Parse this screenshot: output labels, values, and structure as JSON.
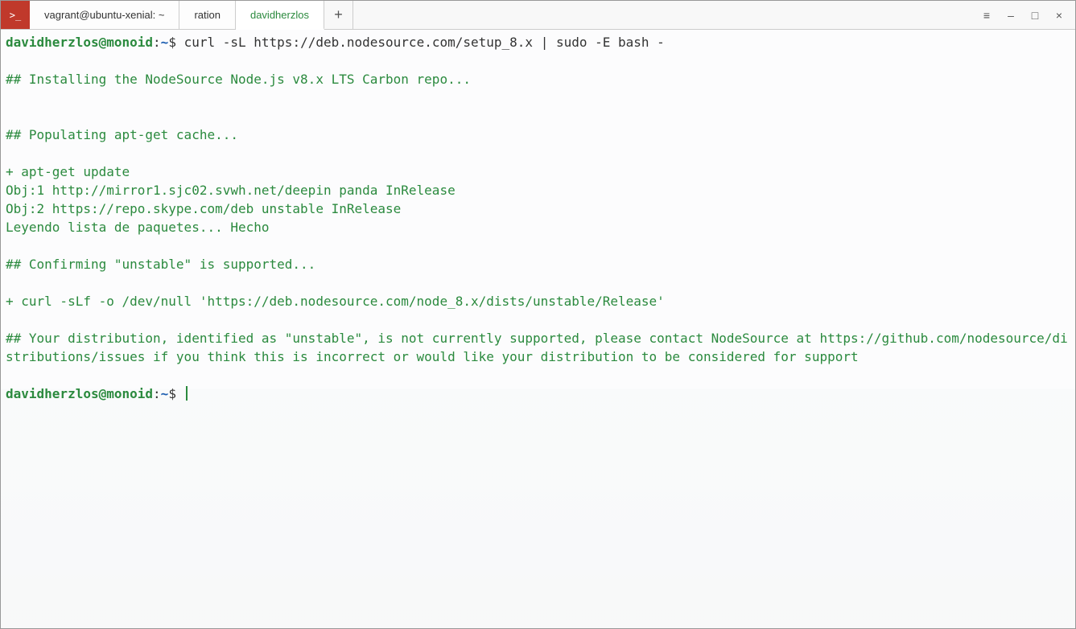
{
  "titlebar": {
    "app_icon_glyph": ">_",
    "tabs": [
      {
        "label": "vagrant@ubuntu-xenial: ~",
        "active": false
      },
      {
        "label": "ration",
        "active": false
      },
      {
        "label": "davidherzlos",
        "active": true
      }
    ],
    "new_tab_glyph": "+",
    "controls": {
      "menu": "≡",
      "minimize": "–",
      "maximize": "□",
      "close": "×"
    }
  },
  "prompt": {
    "user": "davidherzlos@monoid",
    "sep1": ":",
    "path": "~",
    "sep2": "$ "
  },
  "session": {
    "command": "curl -sL https://deb.nodesource.com/setup_8.x | sudo -E bash -",
    "lines": [
      "",
      "## Installing the NodeSource Node.js v8.x LTS Carbon repo...",
      "",
      "",
      "## Populating apt-get cache...",
      "",
      "+ apt-get update",
      "Obj:1 http://mirror1.sjc02.svwh.net/deepin panda InRelease",
      "Obj:2 https://repo.skype.com/deb unstable InRelease",
      "Leyendo lista de paquetes... Hecho",
      "",
      "## Confirming \"unstable\" is supported...",
      "",
      "+ curl -sLf -o /dev/null 'https://deb.nodesource.com/node_8.x/dists/unstable/Release'",
      "",
      "## Your distribution, identified as \"unstable\", is not currently supported, please contact NodeSource at https://github.com/nodesource/distributions/issues if you think this is incorrect or would like your distribution to be considered for support",
      ""
    ]
  }
}
